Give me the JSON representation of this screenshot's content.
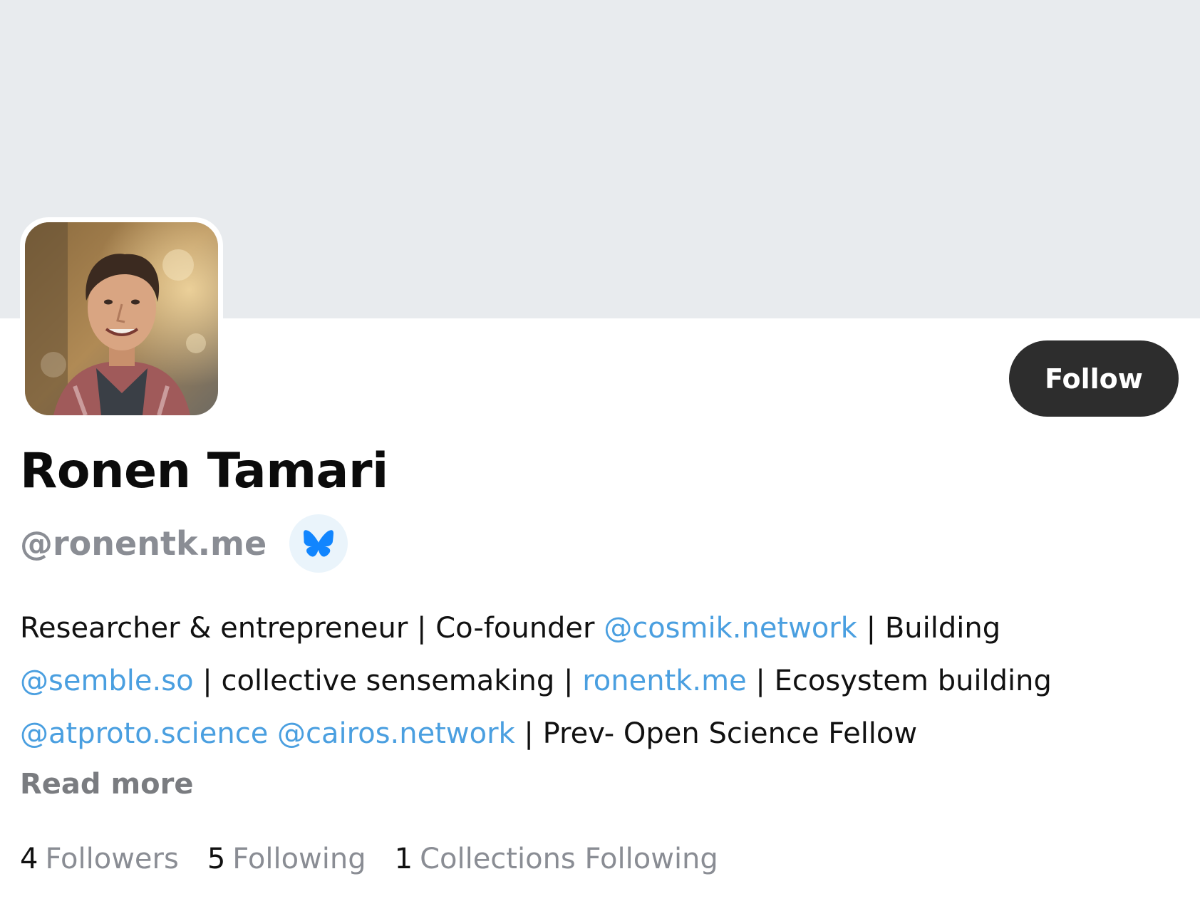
{
  "profile": {
    "name": "Ronen Tamari",
    "handle": "@ronentk.me",
    "follow_label": "Follow",
    "bio": {
      "line1": {
        "t1": "Researcher & entrepreneur | Co-founder ",
        "link1": "@cosmik.network",
        "t2": " | Building"
      },
      "line2": {
        "link1": "@semble.so",
        "t1": " | collective sensemaking | ",
        "link2": "ronentk.me",
        "t2": " | Ecosystem building"
      },
      "line3": {
        "link1": "@atproto.science",
        "t1": " ",
        "link2": "@cairos.network",
        "t2": " | Prev- Open Science Fellow"
      }
    },
    "read_more": "Read more"
  },
  "stats": {
    "followers": {
      "count": "4",
      "label": "Followers"
    },
    "following": {
      "count": "5",
      "label": "Following"
    },
    "collections": {
      "count": "1",
      "label": "Collections Following"
    }
  },
  "icons": {
    "badge": "bluesky-butterfly-icon"
  },
  "colors": {
    "banner": "#e8ebee",
    "link": "#4a9fe0",
    "button": "#2d2d2d",
    "muted": "#8a8d94",
    "butterfly": "#1185fe"
  }
}
